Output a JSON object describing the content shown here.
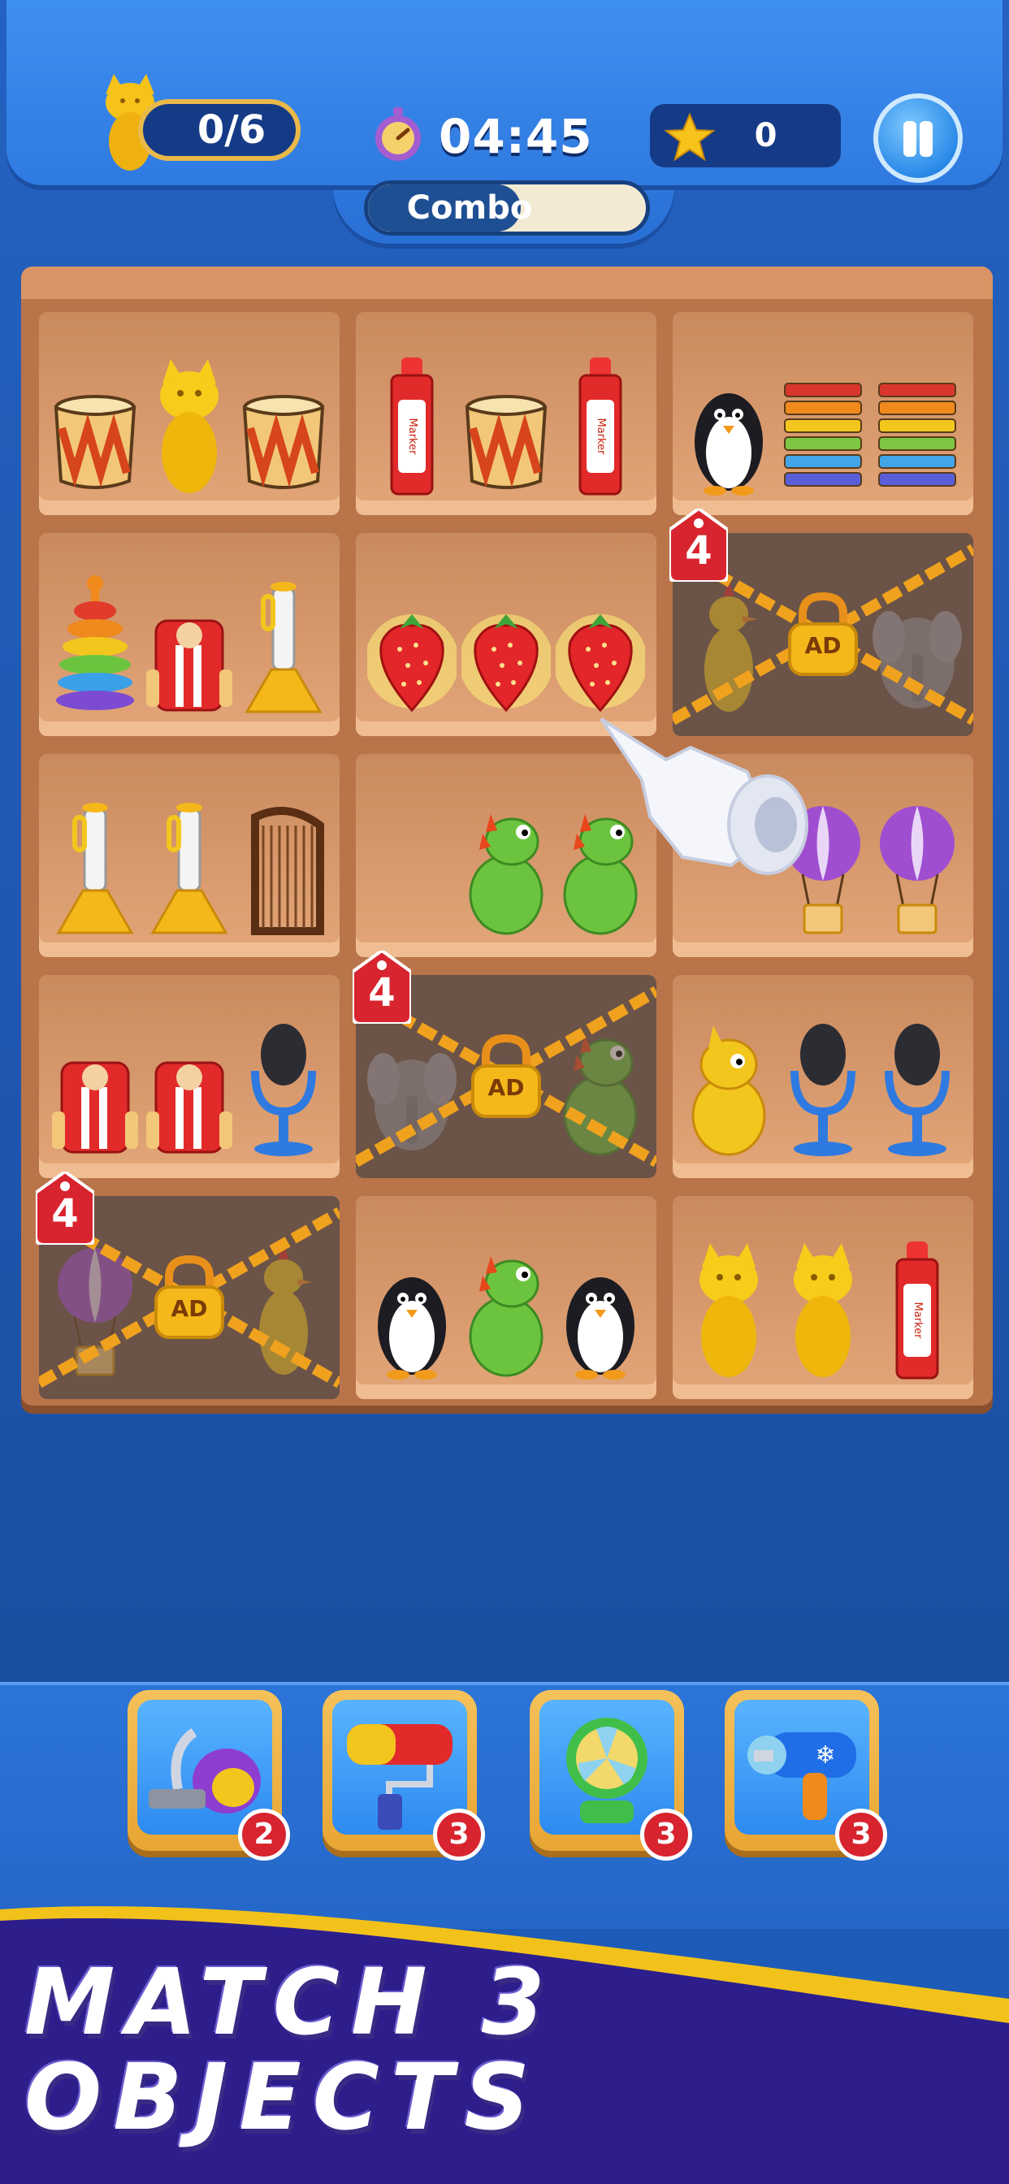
{
  "hud": {
    "goal_progress": "0/6",
    "timer": "04:45",
    "stars": "0",
    "combo_label": "Combo",
    "combo_fill_fraction": 0.55,
    "icons": {
      "goal": "golden-cat-icon",
      "timer": "stopwatch-icon",
      "star": "star-icon",
      "pause": "pause-icon"
    }
  },
  "board": {
    "rows": 5,
    "cols": 3,
    "cells": [
      {
        "items": [
          "drum",
          "golden-cat",
          "drum"
        ],
        "locked": false
      },
      {
        "items": [
          "marker",
          "drum",
          "marker"
        ],
        "locked": false
      },
      {
        "items": [
          "penguin",
          "xylophone",
          "xylophone"
        ],
        "locked": false
      },
      {
        "items": [
          "ring-stacker",
          "race-car",
          "trumpet"
        ],
        "locked": false
      },
      {
        "items": [
          "strawberry",
          "strawberry",
          "strawberry"
        ],
        "locked": false,
        "highlight": true
      },
      {
        "items": [
          "squeaky-chicken",
          "lock-ad",
          "elephant"
        ],
        "locked": true,
        "lock_count": "4",
        "lock_label": "AD"
      },
      {
        "items": [
          "trumpet",
          "trumpet",
          "harp"
        ],
        "locked": false
      },
      {
        "items": [
          "",
          "dinosaur",
          "dinosaur"
        ],
        "locked": false
      },
      {
        "items": [
          "",
          "hot-air-balloon",
          "hot-air-balloon"
        ],
        "locked": false
      },
      {
        "items": [
          "race-car",
          "race-car",
          "microphone"
        ],
        "locked": false
      },
      {
        "items": [
          "elephant",
          "lock-ad",
          "dinosaur"
        ],
        "locked": true,
        "lock_count": "4",
        "lock_label": "AD"
      },
      {
        "items": [
          "yellow-dinosaur",
          "microphone",
          "microphone"
        ],
        "locked": false
      },
      {
        "items": [
          "hot-air-balloon",
          "lock-ad",
          "squeaky-chicken"
        ],
        "locked": true,
        "lock_count": "4",
        "lock_label": "AD"
      },
      {
        "items": [
          "penguin",
          "dinosaur",
          "penguin"
        ],
        "locked": false
      },
      {
        "items": [
          "golden-cat",
          "golden-cat",
          "marker"
        ],
        "locked": false
      }
    ],
    "marker_text": "Marker"
  },
  "boosters": [
    {
      "name": "vacuum",
      "icon": "vacuum-icon",
      "count": "2"
    },
    {
      "name": "paint-roller",
      "icon": "paint-roller-icon",
      "count": "3"
    },
    {
      "name": "fan",
      "icon": "fan-icon",
      "count": "3"
    },
    {
      "name": "freeze-gun",
      "icon": "freeze-gun-icon",
      "count": "3"
    }
  ],
  "banner": {
    "line1": "MATCH 3",
    "line2": "OBJECTS"
  },
  "colors": {
    "background": "#1f58b4",
    "hud": "#3584e8",
    "shelf": "#b9744a",
    "pill_border": "#e9b94a",
    "badge": "#d8242f",
    "banner_purple": "#2d1e8c",
    "banner_gold": "#f2c21b"
  }
}
